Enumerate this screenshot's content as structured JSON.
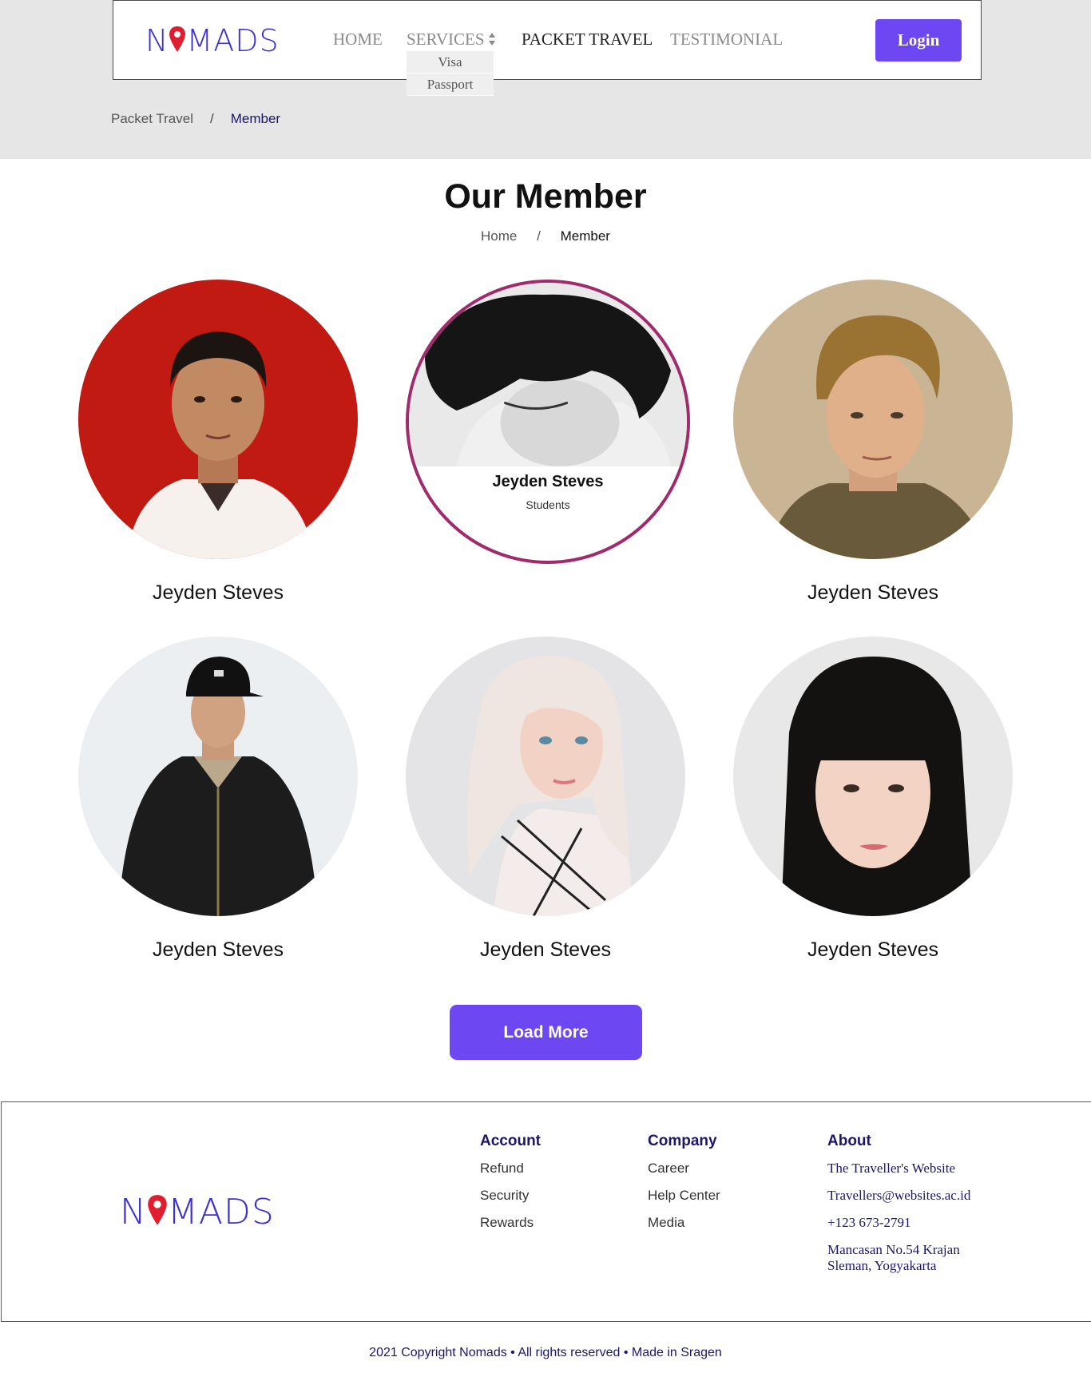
{
  "brand": {
    "logo_text_left": "N",
    "logo_text_right": "MADS",
    "accent": "#6c47f2",
    "logo_color": "#3b2fd6",
    "pin_color": "#e01e2f"
  },
  "nav": {
    "home": "HOME",
    "services": "SERVICES",
    "packet_travel": "PACKET TRAVEL",
    "testimonial": "TESTIMONIAL",
    "services_dropdown": [
      "Visa",
      "Passport"
    ],
    "login": "Login",
    "sort_icon": "sort-arrows-icon"
  },
  "breadcrumb_top": {
    "parent": "Packet Travel",
    "separator": "/",
    "current": "Member"
  },
  "page": {
    "title": "Our Member",
    "breadcrumb": {
      "home": "Home",
      "separator": "/",
      "current": "Member"
    }
  },
  "members": [
    {
      "name": "Jeyden Steves",
      "photo": "portrait-red-background"
    },
    {
      "name": "Jeyden Steves",
      "role": "Students",
      "photo": "portrait-black-white",
      "hover": true
    },
    {
      "name": "Jeyden Steves",
      "photo": "portrait-blond-man"
    },
    {
      "name": "Jeyden Steves",
      "photo": "portrait-man-cap"
    },
    {
      "name": "Jeyden Steves",
      "photo": "portrait-blonde-woman"
    },
    {
      "name": "Jeyden Steves",
      "photo": "portrait-woman-bangs"
    }
  ],
  "load_more": "Load More",
  "footer": {
    "account": {
      "title": "Account",
      "links": [
        "Refund",
        "Security",
        "Rewards"
      ]
    },
    "company": {
      "title": "Company",
      "links": [
        "Career",
        "Help Center",
        "Media"
      ]
    },
    "about": {
      "title": "About",
      "tagline": "The Traveller's Website",
      "email": "Travellers@websites.ac.id",
      "phone": "+123 673-2791",
      "address": "Mancasan No.54 Krajan Sleman, Yogyakarta"
    }
  },
  "copyright": "2021 Copyright Nomads • All rights reserved • Made in Sragen"
}
